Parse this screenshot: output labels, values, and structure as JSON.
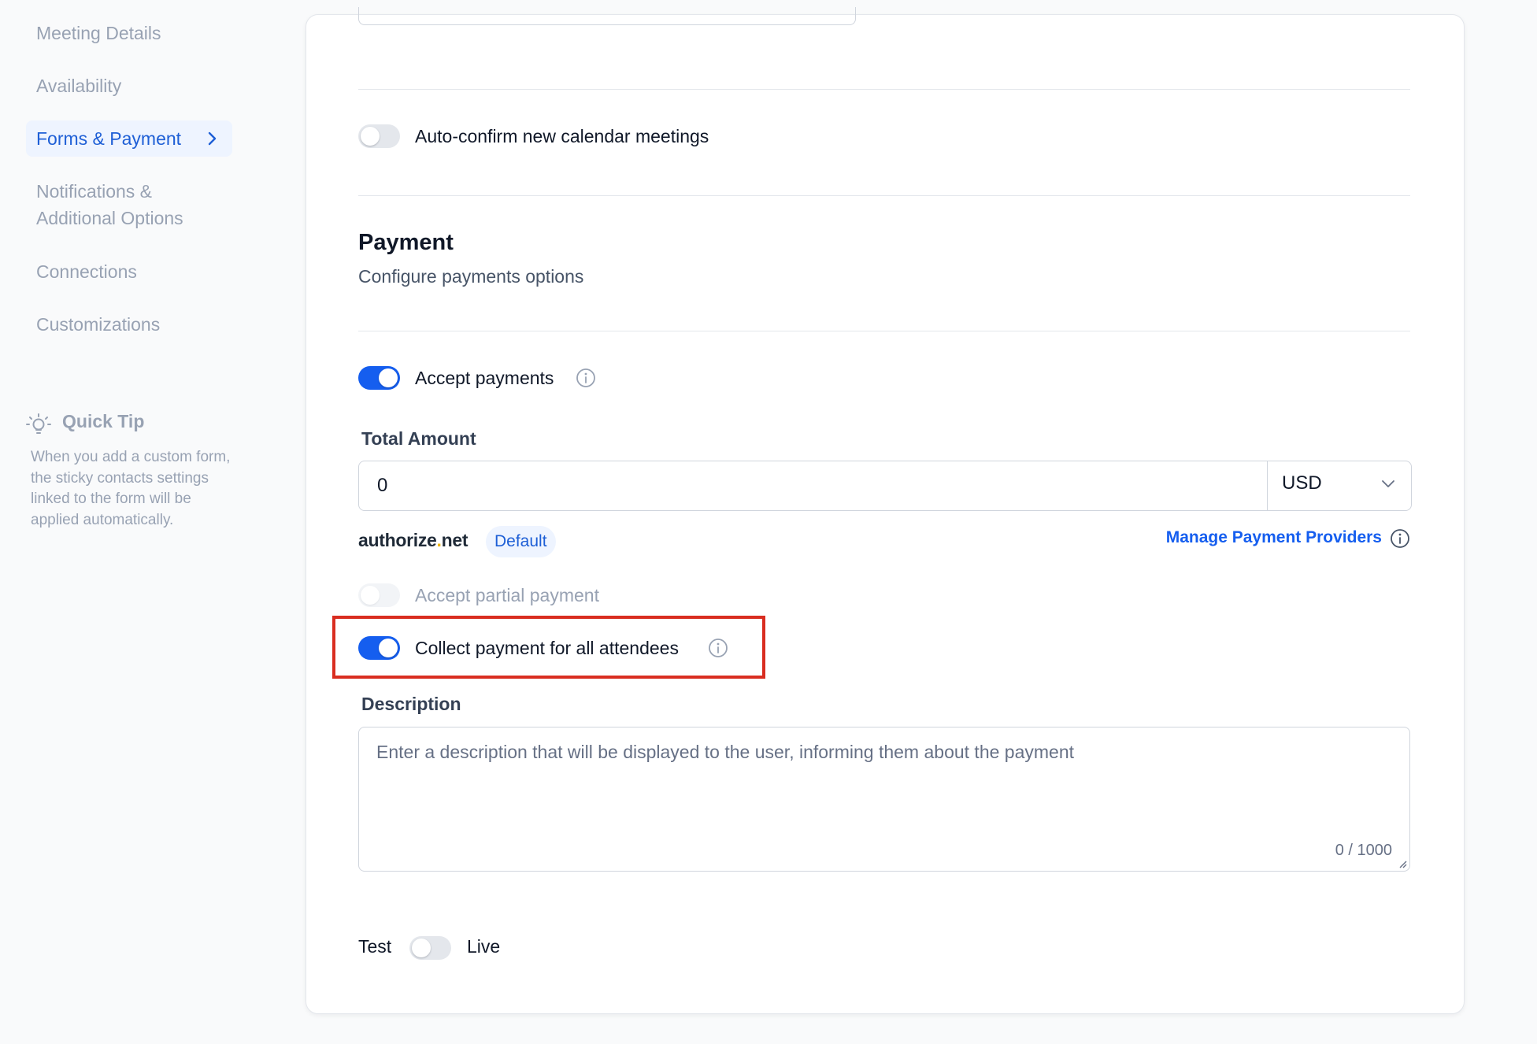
{
  "sidebar": {
    "items": [
      {
        "label": "Meeting Details"
      },
      {
        "label": "Availability"
      },
      {
        "label": "Forms & Payment"
      },
      {
        "label": "Notifications & Additional Options"
      },
      {
        "label": "Connections"
      },
      {
        "label": "Customizations"
      }
    ],
    "active_item": "Forms & Payment",
    "quick_tip": {
      "title": "Quick Tip",
      "text": "When you add a custom form, the sticky contacts settings linked to the form will be applied automatically."
    }
  },
  "settings": {
    "auto_confirm": {
      "label": "Auto-confirm new calendar meetings",
      "enabled": false
    }
  },
  "payment": {
    "title": "Payment",
    "subtitle": "Configure payments options",
    "accept_payments": {
      "label": "Accept payments",
      "enabled": true
    },
    "total_amount": {
      "label": "Total Amount",
      "value": "0",
      "currency": "USD"
    },
    "provider": {
      "name_main": "authorize",
      "name_dot": ".",
      "name_suffix": "net",
      "badge": "Default"
    },
    "manage_link": "Manage Payment Providers",
    "partial_payment": {
      "label": "Accept partial payment",
      "enabled": false,
      "disabled": true
    },
    "collect_all": {
      "label": "Collect payment for all attendees",
      "enabled": true
    },
    "description": {
      "label": "Description",
      "placeholder": "Enter a description that will be displayed to the user, informing them about the payment",
      "value": "",
      "counter": "0 / 1000"
    },
    "mode": {
      "test_label": "Test",
      "live_label": "Live",
      "live_enabled": false
    }
  },
  "colors": {
    "accent": "#155eef",
    "highlight": "#d92d20"
  }
}
